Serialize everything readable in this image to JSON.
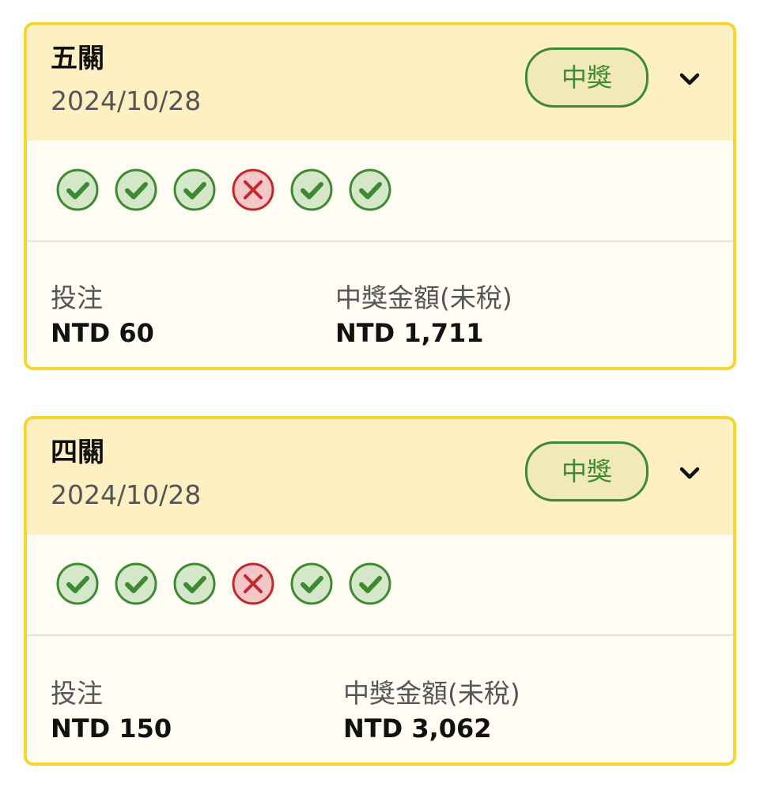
{
  "bets": [
    {
      "title": "五關",
      "date": "2024/10/28",
      "status": "中獎",
      "legs": [
        "win",
        "win",
        "win",
        "loss",
        "win",
        "win"
      ],
      "stake_label": "投注",
      "stake_value": "NTD 60",
      "payout_label": "中獎金額(未稅)",
      "payout_value": "NTD 1,711"
    },
    {
      "title": "四關",
      "date": "2024/10/28",
      "status": "中獎",
      "legs": [
        "win",
        "win",
        "win",
        "loss",
        "win",
        "win"
      ],
      "stake_label": "投注",
      "stake_value": "NTD 150",
      "payout_label": "中獎金額(未稅)",
      "payout_value": "NTD 3,062"
    }
  ],
  "icons": {
    "expand": "chevron-down-icon",
    "win": "check-circle-icon",
    "loss": "x-circle-icon"
  },
  "colors": {
    "card_border": "#f7d430",
    "header_bg": "#fdf1c4",
    "win_green": "#3e8a32",
    "win_fill": "#d4e7c8",
    "loss_red": "#c4262e",
    "loss_fill": "#f3c7c7"
  }
}
